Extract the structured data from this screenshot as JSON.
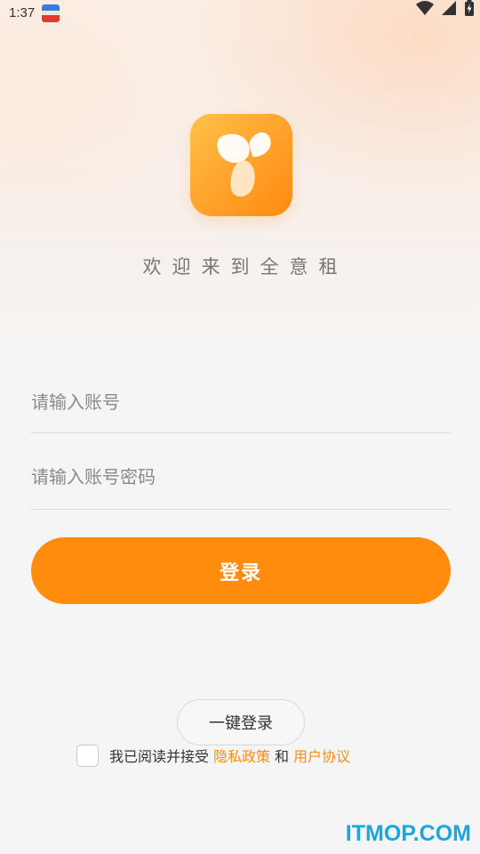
{
  "status_bar": {
    "time": "1:37",
    "notification_icon": "app-notification-icon",
    "icons": [
      "wifi-icon",
      "cellular-signal-icon",
      "battery-charging-icon"
    ]
  },
  "brand": {
    "logo_icon": "app-logo",
    "welcome": "欢迎来到全意租",
    "accent_color": "#ff8c0d"
  },
  "form": {
    "account_placeholder": "请输入账号",
    "account_value": "",
    "password_placeholder": "请输入账号密码",
    "password_value": "",
    "login_label": "登录"
  },
  "one_click_login_label": "一键登录",
  "agreement": {
    "checked": false,
    "prefix": "我已阅读并接受",
    "privacy_link": "隐私政策",
    "and": "和",
    "user_agreement_link": "用户协议"
  },
  "watermark": "ITMOP.COM"
}
